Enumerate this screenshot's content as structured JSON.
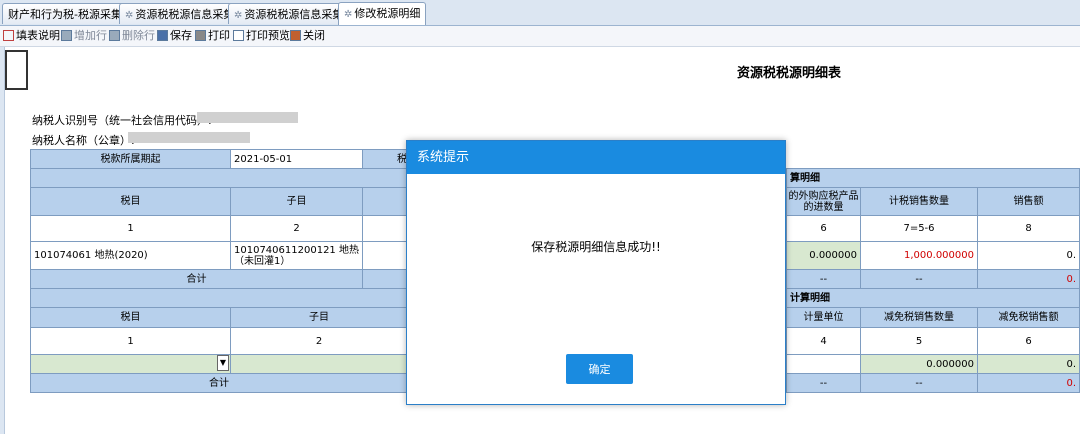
{
  "tabs": [
    {
      "label": "财产和行为税-税源采集"
    },
    {
      "label": "资源税税源信息采集"
    },
    {
      "label": "资源税税源信息采集"
    },
    {
      "label": "修改税源明细"
    }
  ],
  "toolbar": {
    "fill_guide": "填表说明",
    "add_row": "增加行",
    "delete_row": "删除行",
    "save": "保存",
    "print": "打印",
    "print_preview": "打印预览",
    "close": "关闭"
  },
  "page": {
    "title": "资源税税源明细表",
    "taxpayer_id_label": "纳税人识别号（统一社会信用代码）:",
    "taxpayer_name_label": "纳税人名称（公章）:"
  },
  "table1": {
    "period_label": "税款所属期起",
    "period_value": "2021-05-01",
    "period_to_fragment": "税",
    "section_title_fragment": "算明细",
    "col_taxitem": "税目",
    "col_subitem": "子目",
    "col_purchase": "的外购应税产品的进数量",
    "col_tax_qty": "计税销售数量",
    "col_sales": "销售额",
    "idx1": "1",
    "idx2": "2",
    "idx6": "6",
    "idx7": "7=5-6",
    "idx8": "8",
    "row_taxitem": "101074061 地热(2020)",
    "row_subitem": "1010740611200121 地热（未回灌1）",
    "row_purchase": "0.000000",
    "row_tax_qty": "1,000.000000",
    "row_sales": "0.",
    "total_label": "合计",
    "total_dash1": "--",
    "total_dash2": "--",
    "total_sales": "0."
  },
  "table2": {
    "section_title_fragment": "计算明细",
    "col_taxitem": "税目",
    "col_subitem": "子目",
    "col_unit": "计量单位",
    "col_exempt_qty": "减免税销售数量",
    "col_exempt_sales": "减免税销售额",
    "idx1": "1",
    "idx2": "2",
    "idx4": "4",
    "idx5": "5",
    "idx6": "6",
    "row_exempt_qty": "0.000000",
    "row_exempt_sales": "0.",
    "total_label": "合计",
    "total_dash1": "--",
    "total_dash2": "--",
    "total_sales": "0."
  },
  "dialog": {
    "title": "系统提示",
    "message": "保存税源明细信息成功!!",
    "ok": "确定"
  },
  "colors": {
    "header_blue": "#b7d0ec",
    "dialog_blue": "#1a8be0",
    "error_red": "#d00000"
  }
}
